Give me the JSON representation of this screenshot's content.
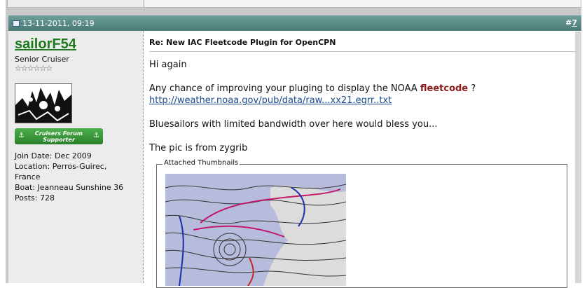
{
  "post": {
    "date": "13-11-2011, 09:19",
    "number_prefix": "#",
    "number": "7",
    "title": "Re: New IAC Fleetcode Plugin for OpenCPN"
  },
  "user": {
    "name": "sailorF54",
    "title": "Senior Cruiser",
    "stars": "☆☆☆☆☆☆",
    "badge_line1": "Cruisers Forum",
    "badge_line2": "Supporter",
    "join": "Join Date: Dec 2009",
    "location": "Location: Perros-Guirec, France",
    "boat": "Boat: Jeanneau Sunshine 36",
    "posts": "Posts: 728"
  },
  "message": {
    "line1": "Hi again",
    "line2_a": "Any chance of improving your pluging to display the NOAA ",
    "line2_hl": "fleetcode",
    "line2_b": " ?",
    "link": "http://weather.noaa.gov/pub/data/raw...xx21.egrr..txt",
    "line3": "Bluesailors with limited bandwidth over here would bless you...",
    "line4": "The pic is from zygrib",
    "attachments_label": "Attached Thumbnails"
  },
  "icons": {
    "post": "post-icon",
    "anchor": "anchor-icon"
  },
  "colors": {
    "header": "#5b8b87",
    "username": "#1f7a1f",
    "highlight": "#8b1a1a",
    "link": "#1b4b8c",
    "badge": "#3a9a3a"
  }
}
